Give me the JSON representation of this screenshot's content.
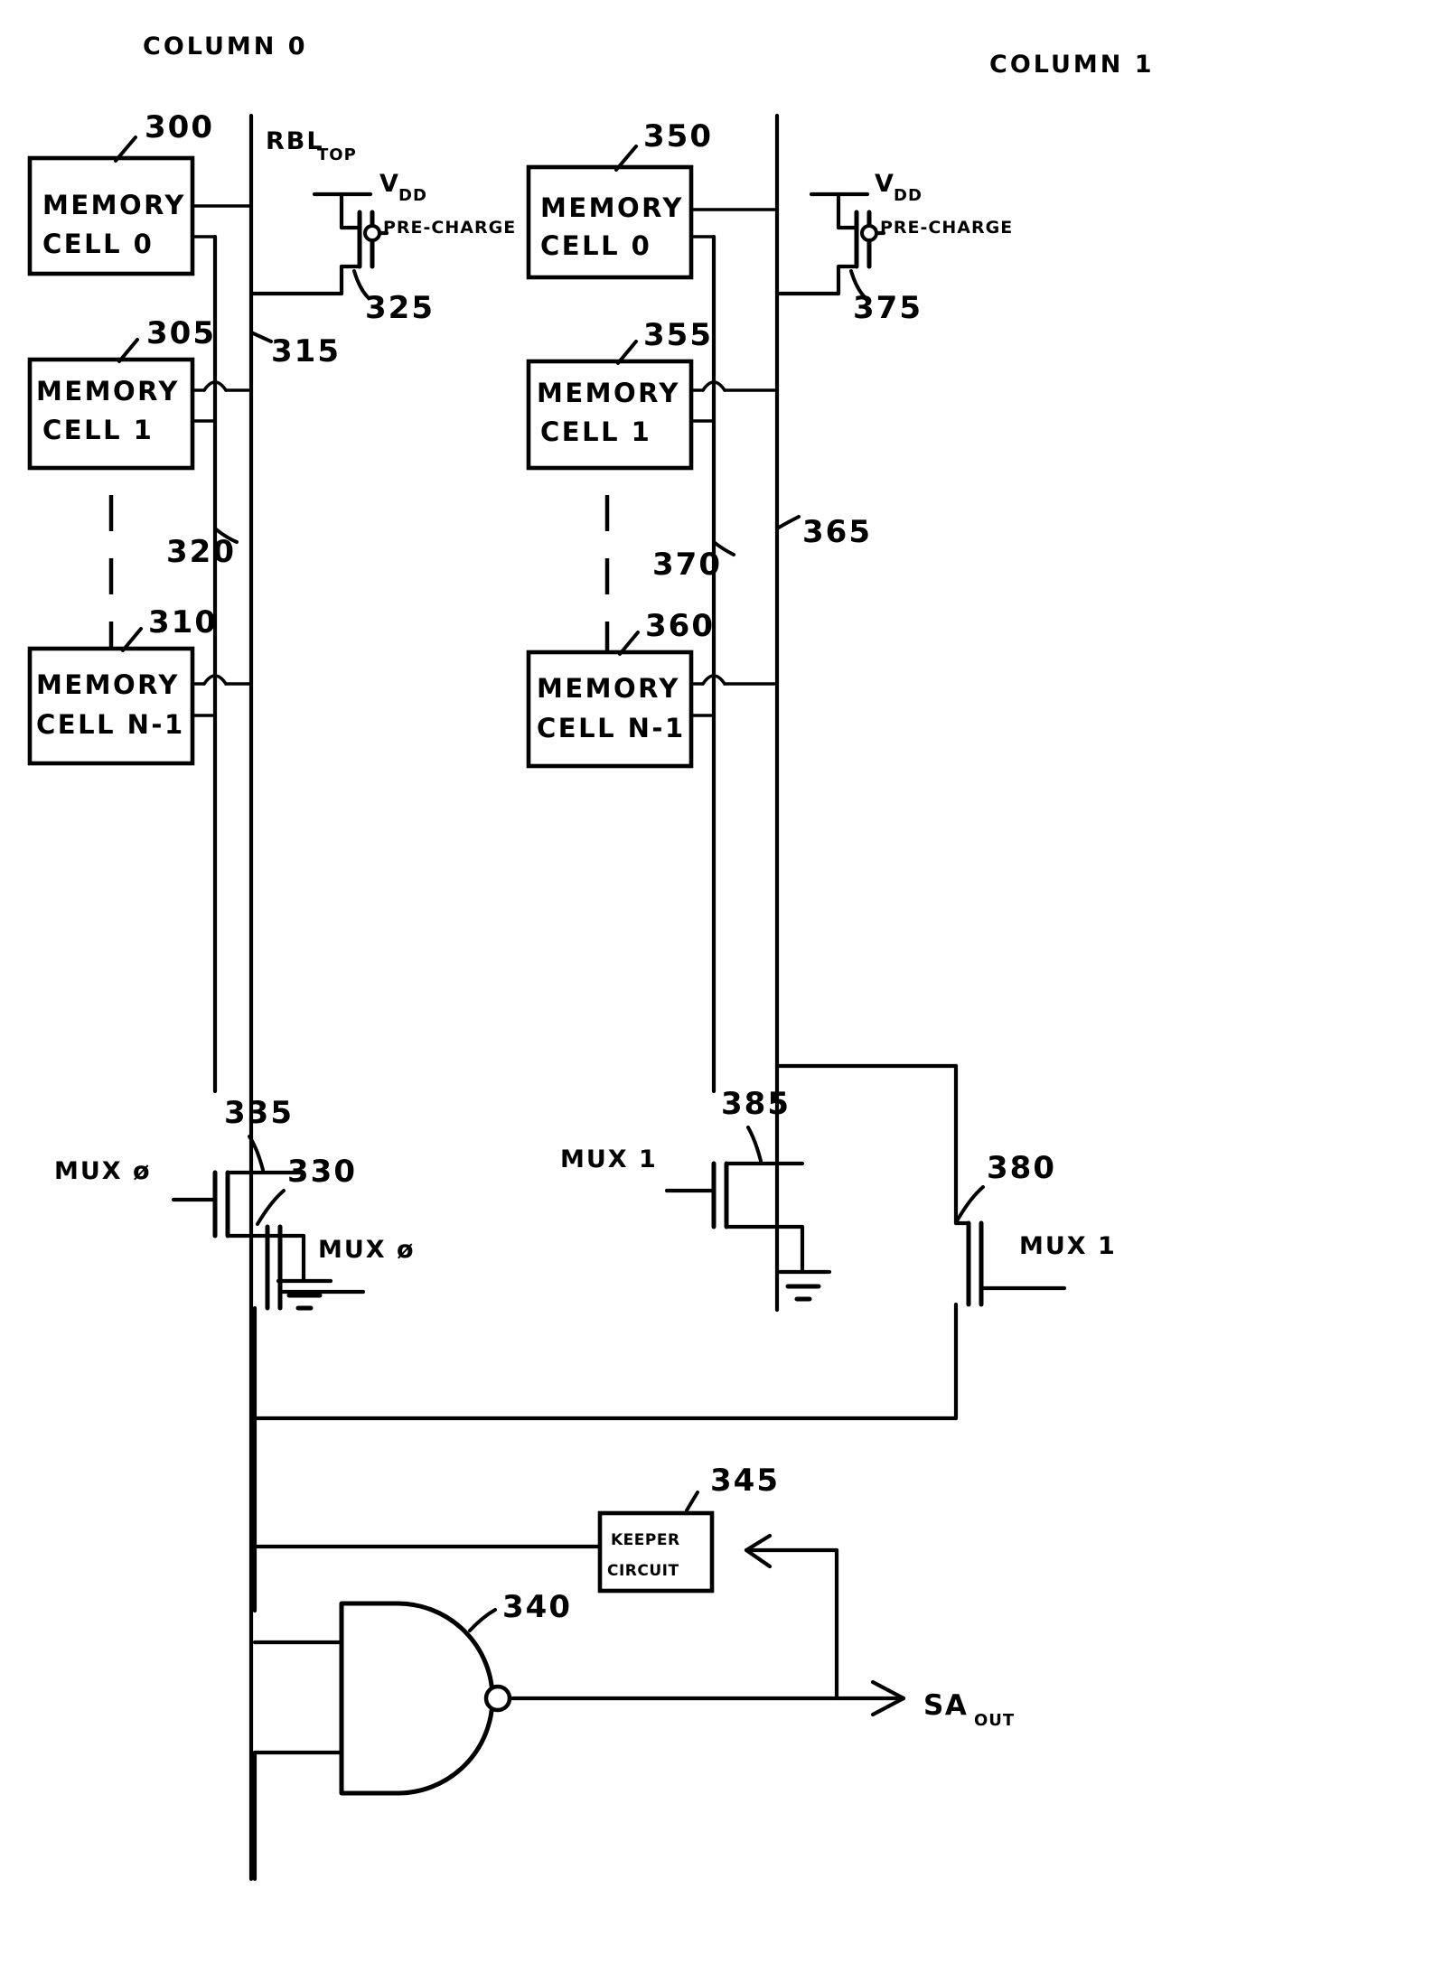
{
  "diagram": {
    "title": "SRAM read bitline with precharge, column mux and sense amplifier",
    "headers": {
      "column0": "COLUMN  0",
      "column1": "COLUMN  1"
    },
    "column0": {
      "bitline_label": "RBL",
      "bitline_sub": "TOP",
      "cells": [
        {
          "ref": "300",
          "line1": "MEMORY",
          "line2": "CELL 0"
        },
        {
          "ref": "305",
          "line1": "MEMORY",
          "line2": "CELL 1"
        },
        {
          "ref": "310",
          "line1": "MEMORY",
          "line2": "CELL N-1"
        }
      ],
      "wire_refs": [
        "315",
        "320"
      ],
      "precharge": {
        "ref": "325",
        "supply": "V",
        "supply_sub": "DD",
        "signal": "PRE-CHARGE"
      },
      "mux_pass": {
        "ref": "330",
        "signal": "MUX ø"
      },
      "mux_pull": {
        "ref": "335",
        "signal": "MUX ø"
      }
    },
    "column1": {
      "cells": [
        {
          "ref": "350",
          "line1": "MEMORY",
          "line2": "CELL 0"
        },
        {
          "ref": "355",
          "line1": "MEMORY",
          "line2": "CELL 1"
        },
        {
          "ref": "360",
          "line1": "MEMORY",
          "line2": "CELL N-1"
        }
      ],
      "wire_refs": [
        "365",
        "370"
      ],
      "precharge": {
        "ref": "375",
        "supply": "V",
        "supply_sub": "DD",
        "signal": "PRE-CHARGE"
      },
      "mux_pass": {
        "ref": "380",
        "signal": "MUX 1"
      },
      "mux_pull": {
        "ref": "385",
        "signal": "MUX 1"
      }
    },
    "sense": {
      "nand": {
        "ref": "340"
      },
      "keeper": {
        "ref": "345",
        "line1": "KEEPER",
        "line2": "CIRCUIT"
      },
      "output": {
        "label": "SA",
        "sub": "OUT"
      }
    }
  }
}
